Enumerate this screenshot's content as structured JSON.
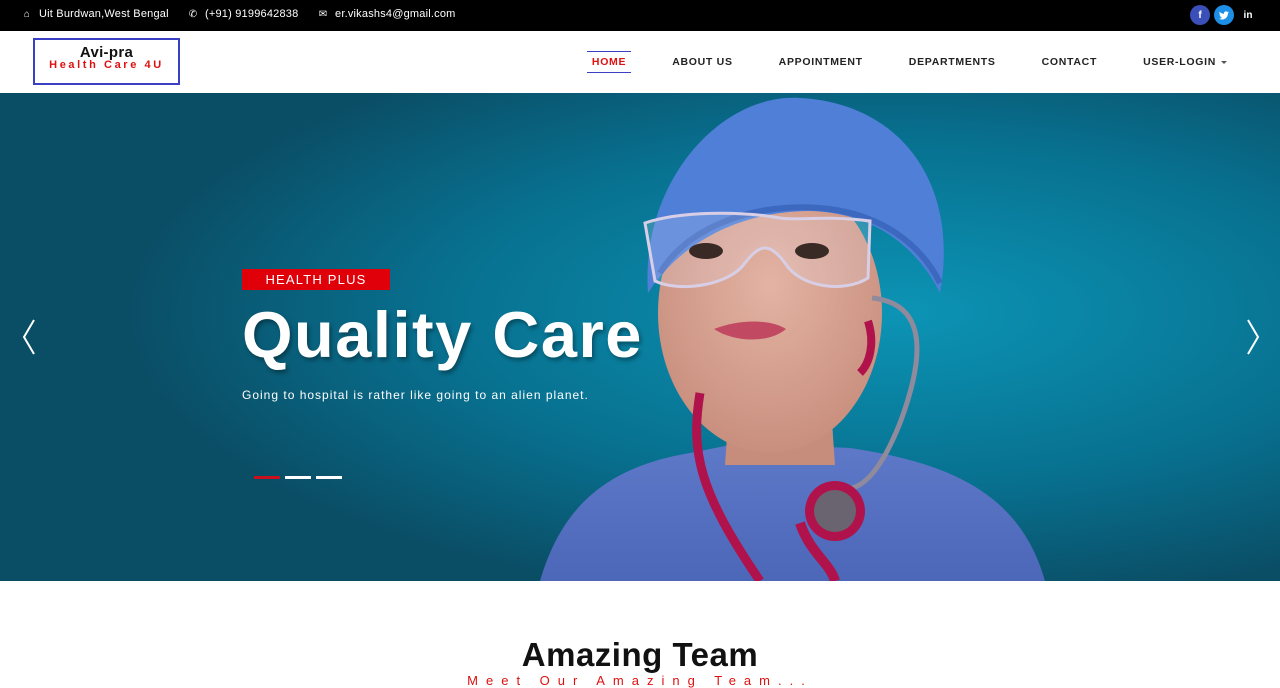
{
  "topbar": {
    "address": "Uit Burdwan,West Bengal",
    "phone": "(+91) 9199642838",
    "email": "er.vikashs4@gmail.com",
    "socials": [
      {
        "icon": "facebook-icon",
        "glyph": "f",
        "color": "#3b4fb8"
      },
      {
        "icon": "twitter-icon",
        "glyph": "t",
        "color": "#1d8fe6"
      },
      {
        "icon": "linkedin-icon",
        "glyph": "in",
        "color": "#000000"
      }
    ]
  },
  "logo": {
    "line1": "Avi-pra",
    "line2": "Health Care 4U"
  },
  "nav": {
    "items": [
      "HOME",
      "ABOUT US",
      "APPOINTMENT",
      "DEPARTMENTS",
      "CONTACT",
      "USER-LOGIN"
    ],
    "active": "HOME"
  },
  "hero": {
    "badge": "HEALTH PLUS",
    "title": "Quality Care",
    "subtitle": "Going to hospital is rather like going to an alien planet.",
    "slides": 3,
    "active_slide": 1
  },
  "team": {
    "title": "Amazing Team",
    "subtitle": "Meet Our Amazing Team..."
  },
  "colors": {
    "accent": "#e0000a",
    "nav_border": "#3b3fc4",
    "hero_bg": "#086d8c"
  }
}
